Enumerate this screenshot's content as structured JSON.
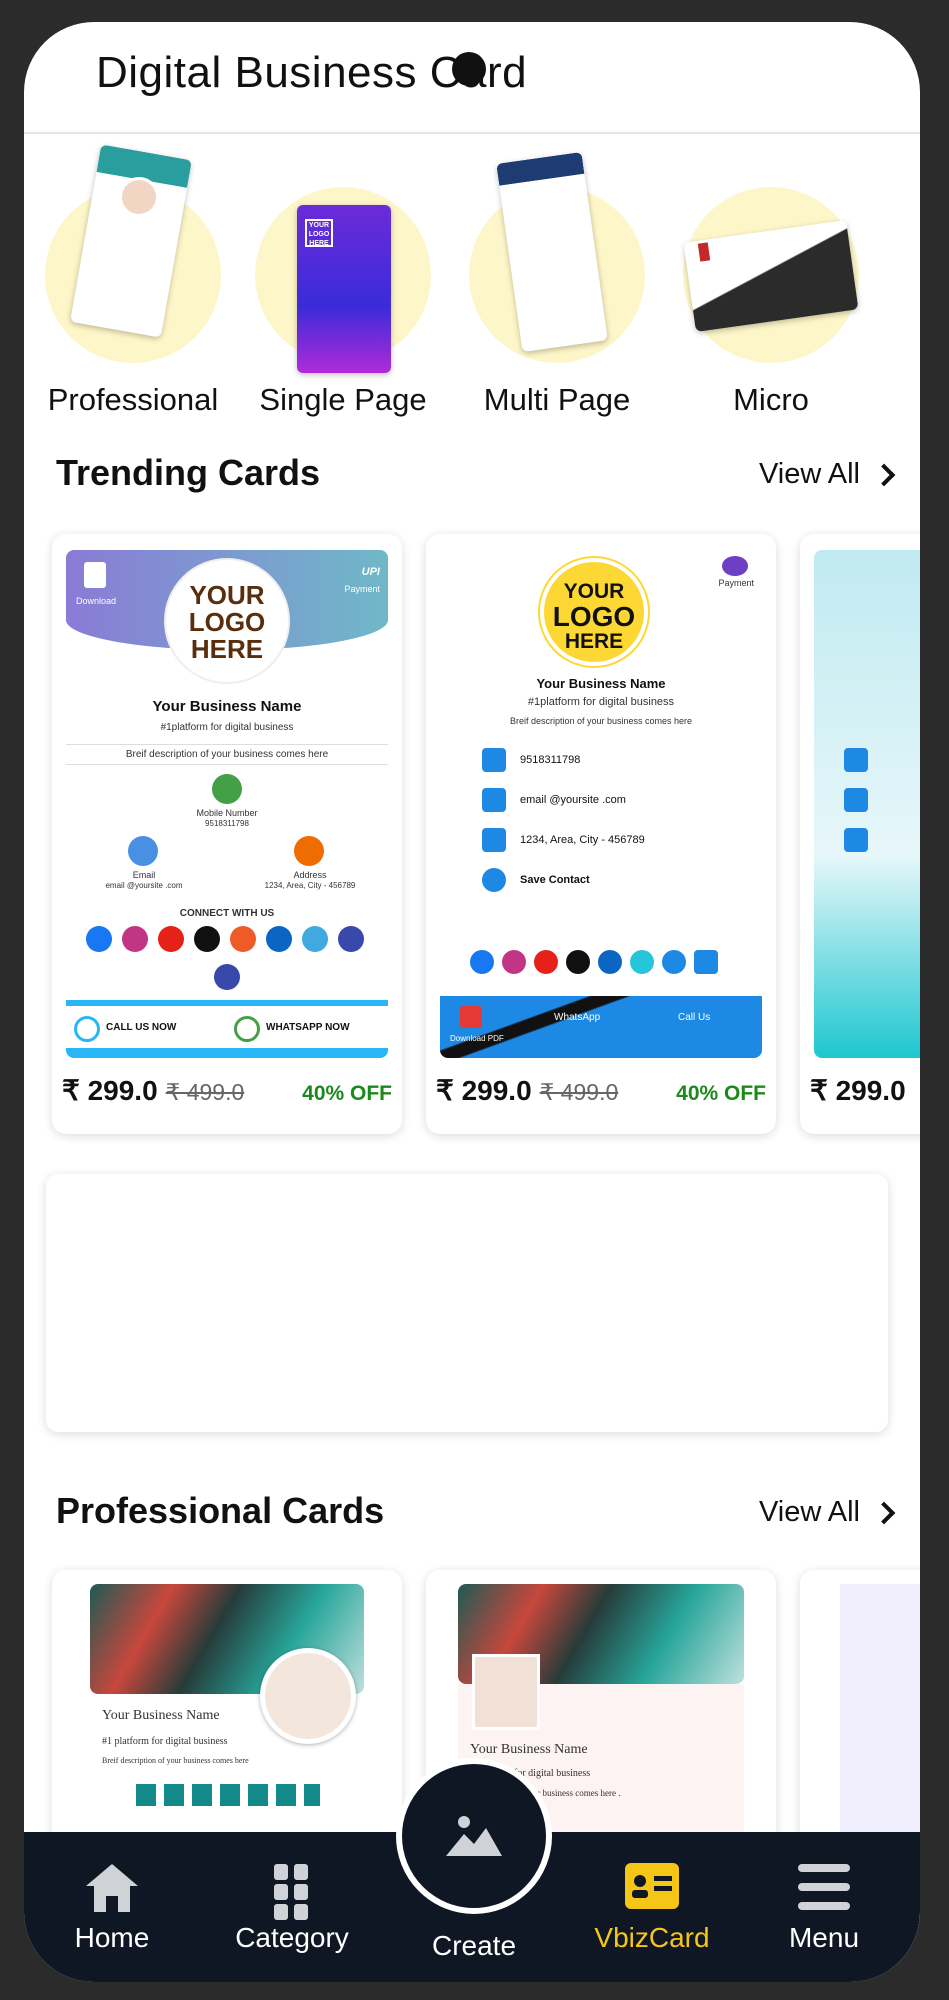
{
  "header": {
    "title": "Digital Business Card"
  },
  "categories": [
    {
      "label": "Professional"
    },
    {
      "label": "Single Page"
    },
    {
      "label": "Multi Page"
    },
    {
      "label": "Micro"
    }
  ],
  "trending": {
    "title": "Trending Cards",
    "view_all": "View All",
    "cards": [
      {
        "price": "₹ 299.0",
        "mrp": "₹ 499.0",
        "off": "40% OFF",
        "logo_l1": "YOUR",
        "logo_l2": "LOGO",
        "logo_l3": "HERE",
        "download": "Download",
        "payment": "Payment",
        "business_name": "Your Business Name",
        "tagline": "#1platform  for digital  business",
        "desc": "Breif description  of your business  comes  here",
        "mobile_label": "Mobile  Number",
        "mobile": "9518311798",
        "email_label": "Email",
        "email": "email @yoursite .com",
        "address_label": "Address",
        "address": "1234, Area, City - 456789",
        "connect": "CONNECT WITH US",
        "call": "CALL US NOW",
        "whatsapp": "WHATSAPP  NOW"
      },
      {
        "price": "₹ 299.0",
        "mrp": "₹ 499.0",
        "off": "40% OFF",
        "logo_l1": "YOUR",
        "logo_l2": "LOGO",
        "logo_l3": "HERE",
        "payment": "Payment",
        "business_name": "Your Business Name",
        "tagline": "#1platform  for digital  business",
        "desc": "Breif description  of your business  comes  here",
        "phone": "9518311798",
        "email": "email @yoursite .com",
        "address": "1234, Area, City - 456789",
        "save": "Save Contact",
        "download_pdf": "Download PDF",
        "whatsapp": "WhatsApp",
        "call": "Call Us"
      },
      {
        "price": "₹ 299.0"
      }
    ]
  },
  "professional": {
    "title": "Professional Cards",
    "view_all": "View All",
    "cards": [
      {
        "business_name": "Your Business Name",
        "tagline": "#1 platform for digital business",
        "desc": "Breif description of your business comes here"
      },
      {
        "business_name": "Your Business   Name",
        "tagline": "for digital  business",
        "desc": "of your business  comes  here ."
      }
    ]
  },
  "nav": {
    "home": "Home",
    "category": "Category",
    "create": "Create",
    "vbizcard": "VbizCard",
    "menu": "Menu"
  },
  "colors": {
    "nav_bg": "#0f1724",
    "accent": "#f5c518",
    "price_off": "#1b8a1b"
  }
}
